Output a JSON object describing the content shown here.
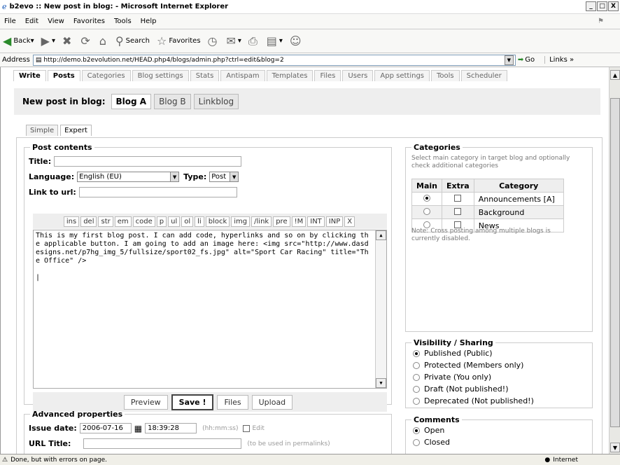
{
  "window": {
    "title": "b2evo :: New post in blog: - Microsoft Internet Explorer",
    "min": "_",
    "max": "□",
    "close": "X"
  },
  "menu": [
    "File",
    "Edit",
    "View",
    "Favorites",
    "Tools",
    "Help"
  ],
  "toolbar": {
    "back": "Back",
    "search": "Search",
    "favorites": "Favorites"
  },
  "address": {
    "label": "Address",
    "url": "http://demo.b2evolution.net/HEAD.php4/blogs/admin.php?ctrl=edit&blog=2",
    "go": "Go",
    "links": "Links"
  },
  "nav_tabs": [
    "Write",
    "Posts",
    "Categories",
    "Blog settings",
    "Stats",
    "Antispam",
    "Templates",
    "Files",
    "Users",
    "App settings",
    "Tools",
    "Scheduler"
  ],
  "blogbar": {
    "label": "New post in blog:",
    "blogs": [
      "Blog A",
      "Blog B",
      "Linkblog"
    ]
  },
  "subtabs": [
    "Simple",
    "Expert"
  ],
  "post": {
    "legend": "Post contents",
    "title_label": "Title:",
    "language_label": "Language:",
    "language_value": "English (EU)",
    "type_label": "Type:",
    "type_value": "Post",
    "link_label": "Link to url:",
    "quicktags": [
      "ins",
      "del",
      "str",
      "em",
      "code",
      "p",
      "ul",
      "ol",
      "li",
      "block",
      "img",
      "/link",
      "pre",
      "!M",
      "INT",
      "INP",
      "X"
    ],
    "content": "This is my first blog post. I can add code, hyperlinks and so on by clicking the applicable button. I am going to add an image here: <img src=\"http://www.dasdesigns.net/p7hg_img_5/fullsize/sport02_fs.jpg\" alt=\"Sport Car Racing\" title=\"The Office\" />\n\n|",
    "buttons": {
      "preview": "Preview",
      "save": "Save !",
      "files": "Files",
      "upload": "Upload"
    }
  },
  "advanced": {
    "legend": "Advanced properties",
    "issue_label": "Issue date:",
    "issue_date": "2006-07-16",
    "issue_time": "18:39:28",
    "time_hint": "(hh:mm:ss)",
    "edit_label": "Edit",
    "url_label": "URL Title:",
    "url_hint": "(to be used in permalinks)"
  },
  "categories": {
    "legend": "Categories",
    "help": "Select main category in target blog and optionally check additional categories",
    "cols": [
      "Main",
      "Extra",
      "Category"
    ],
    "rows": [
      "Announcements [A]",
      "Background",
      "News"
    ],
    "note": "Note: Cross posting among multiple blogs is currently disabled."
  },
  "visibility": {
    "legend": "Visibility / Sharing",
    "options": [
      "Published (Public)",
      "Protected (Members only)",
      "Private (You only)",
      "Draft (Not published!)",
      "Deprecated (Not published!)"
    ]
  },
  "comments": {
    "legend": "Comments",
    "options": [
      "Open",
      "Closed"
    ]
  },
  "status": {
    "text": "Done, but with errors on page.",
    "zone": "Internet"
  }
}
